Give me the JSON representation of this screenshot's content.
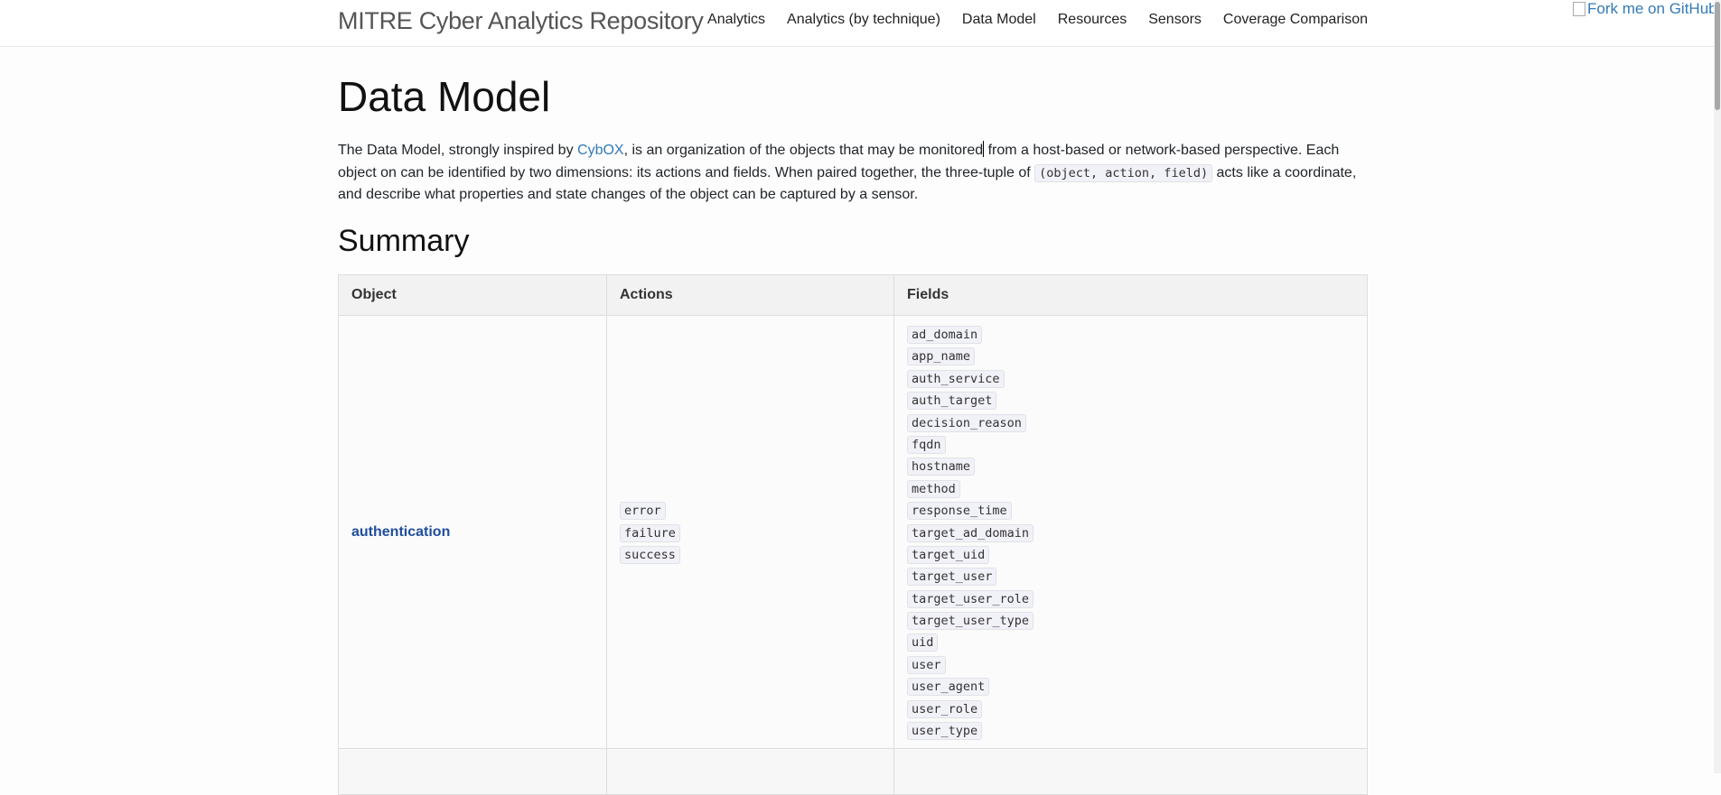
{
  "navbar": {
    "brand": "MITRE Cyber Analytics Repository",
    "links": [
      "Analytics",
      "Analytics (by technique)",
      "Data Model",
      "Resources",
      "Sensors",
      "Coverage Comparison"
    ],
    "fork_alt": "Fork me on GitHub"
  },
  "page": {
    "title": "Data Model",
    "intro": {
      "p1": "The Data Model, strongly inspired by ",
      "link": "CybOX",
      "p2": ", is an organization of the objects that may be monitored",
      "p3": " from a host-based or network-based perspective. Each object on can be identified by two dimensions: its actions and fields. When paired together, the three-tuple of ",
      "code": "(object, action, field)",
      "p4": " acts like a coordinate, and describe what properties and state changes of the object can be captured by a sensor."
    },
    "summary_heading": "Summary"
  },
  "table": {
    "headers": [
      "Object",
      "Actions",
      "Fields"
    ],
    "rows": [
      {
        "object": "authentication",
        "actions": [
          "error",
          "failure",
          "success"
        ],
        "fields": [
          "ad_domain",
          "app_name",
          "auth_service",
          "auth_target",
          "decision_reason",
          "fqdn",
          "hostname",
          "method",
          "response_time",
          "target_ad_domain",
          "target_uid",
          "target_user",
          "target_user_role",
          "target_user_type",
          "uid",
          "user",
          "user_agent",
          "user_role",
          "user_type"
        ]
      }
    ]
  }
}
